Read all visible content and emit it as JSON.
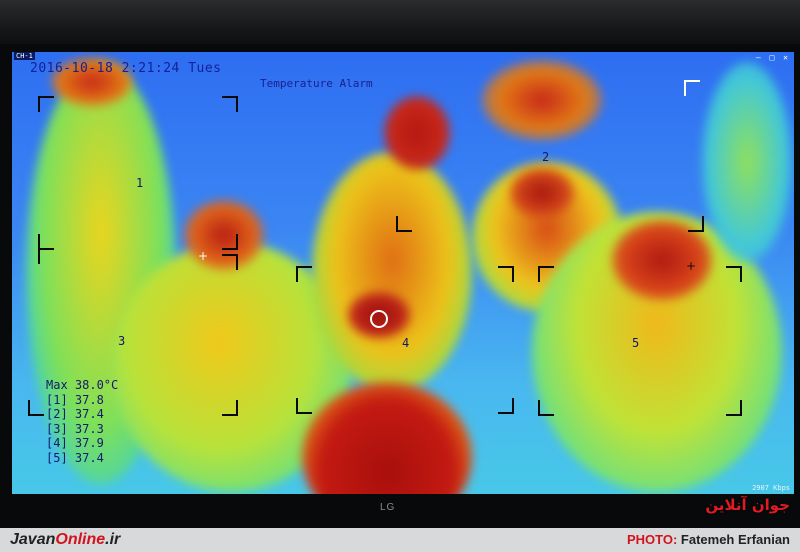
{
  "monitor": {
    "channel": "CH-1",
    "datetime": "2016-10-18  2:21:24 Tues",
    "alarm_label": "Temperature Alarm",
    "bitrate": "2907 Kbps",
    "controls": "— □ ✕",
    "brand": "LG"
  },
  "zones": [
    "1",
    "2",
    "3",
    "4",
    "5"
  ],
  "readings": {
    "max": "Max 38.0°C",
    "list": [
      {
        "id": "[1]",
        "value": "37.8"
      },
      {
        "id": "[2]",
        "value": "37.4"
      },
      {
        "id": "[3]",
        "value": "37.3"
      },
      {
        "id": "[4]",
        "value": "37.9"
      },
      {
        "id": "[5]",
        "value": "37.4"
      }
    ]
  },
  "footer": {
    "site_a": "Javan",
    "site_b": "Online",
    "site_c": ".ir",
    "photo_label": "PHOTO:",
    "photographer": "Fatemeh Erfanian",
    "logo_text": "جوان آنلاین"
  },
  "colors": {
    "hot": "#c81a10",
    "warm": "#f2d21a",
    "mid": "#4fe08a",
    "cool": "#3a82f2",
    "accent": "#d4121f"
  }
}
